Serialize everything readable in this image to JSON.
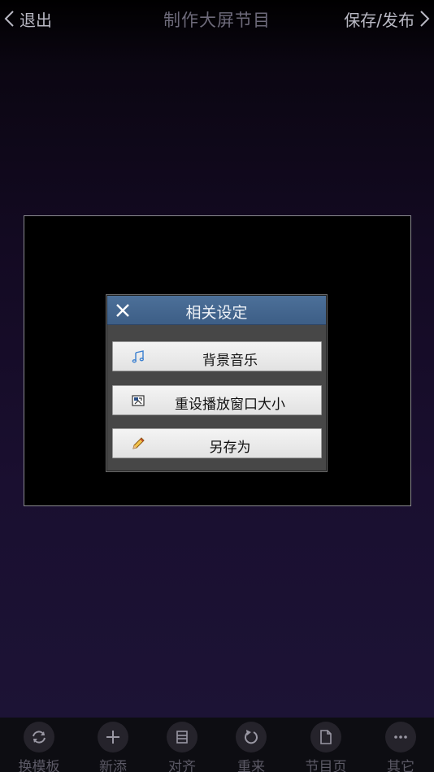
{
  "header": {
    "back_label": "退出",
    "title": "制作大屏节目",
    "save_label": "保存/发布"
  },
  "dialog": {
    "title": "相关设定",
    "buttons": [
      {
        "label": "背景音乐",
        "icon": "music-note-icon"
      },
      {
        "label": "重设播放窗口大小",
        "icon": "resize-window-icon"
      },
      {
        "label": "另存为",
        "icon": "pencil-icon"
      }
    ]
  },
  "toolbar": {
    "items": [
      {
        "label": "换模板",
        "icon": "swap-template-icon"
      },
      {
        "label": "新添",
        "icon": "plus-icon"
      },
      {
        "label": "对齐",
        "icon": "align-icon"
      },
      {
        "label": "重来",
        "icon": "undo-icon"
      },
      {
        "label": "节目页",
        "icon": "page-icon"
      },
      {
        "label": "其它",
        "icon": "more-icon"
      }
    ]
  },
  "colors": {
    "dialog_header": "#3d5e86",
    "dialog_body": "#474747",
    "toolbar_bg": "#0d0d12"
  }
}
